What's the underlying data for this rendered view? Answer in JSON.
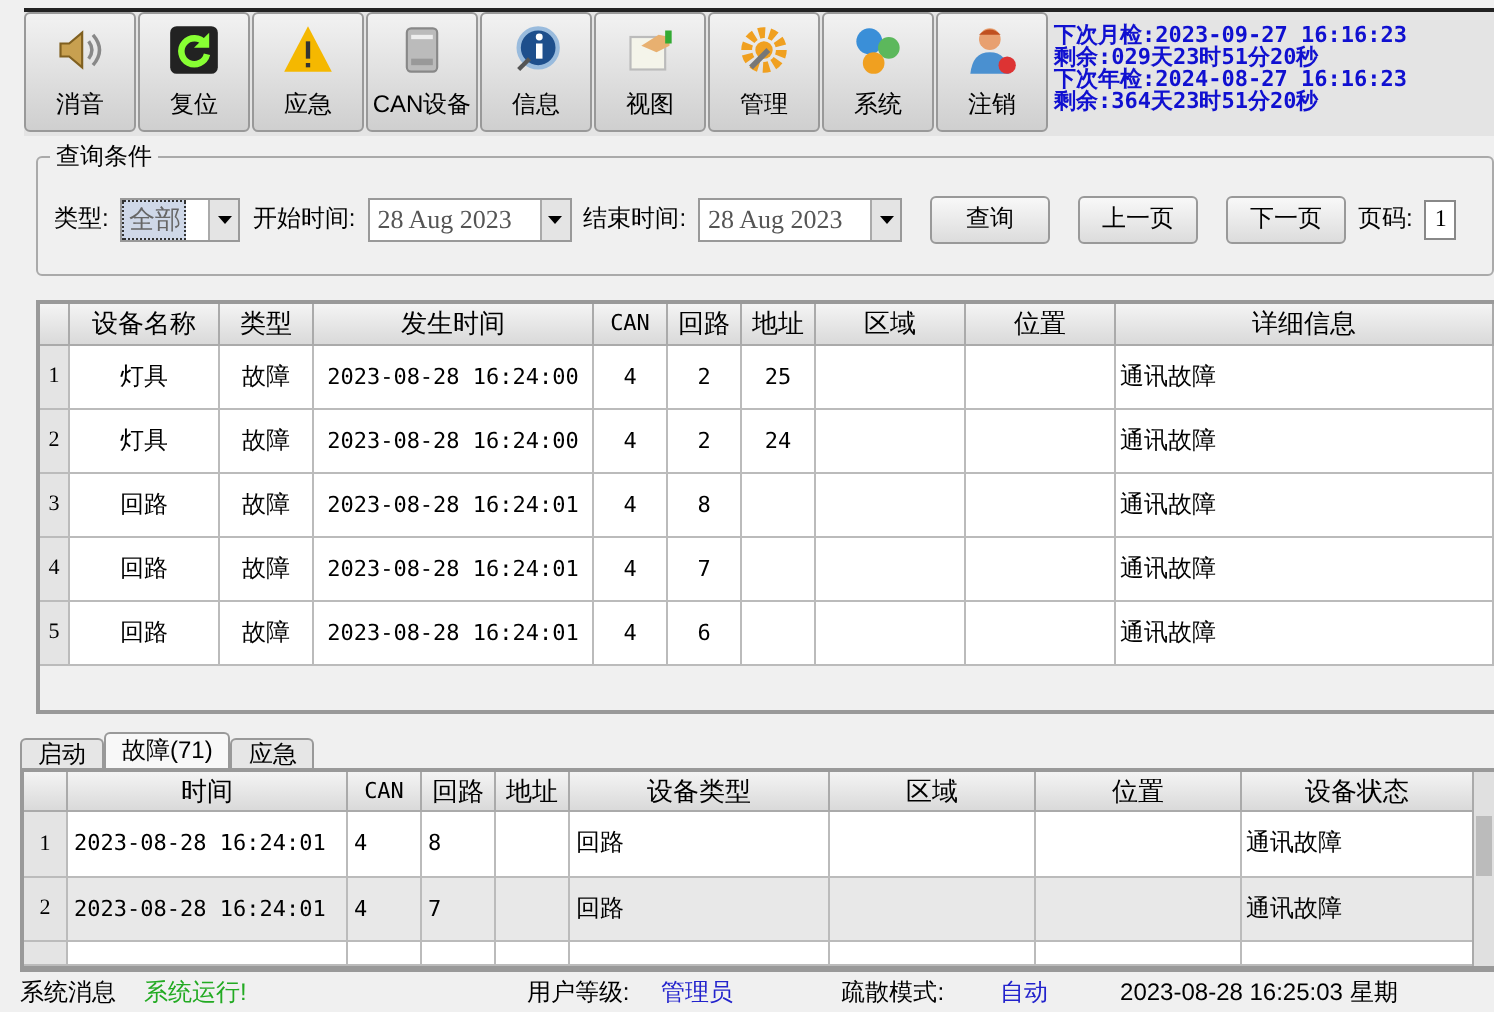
{
  "toolbar": {
    "buttons": [
      {
        "label": "消音"
      },
      {
        "label": "复位"
      },
      {
        "label": "应急"
      },
      {
        "label": "CAN设备"
      },
      {
        "label": "信息"
      },
      {
        "label": "视图"
      },
      {
        "label": "管理"
      },
      {
        "label": "系统"
      },
      {
        "label": "注销"
      }
    ],
    "info_lines": [
      "下次月检:2023-09-27 16:16:23",
      "剩余:029天23时51分20秒",
      "下次年检:2024-08-27 16:16:23",
      "剩余:364天23时51分20秒"
    ]
  },
  "query": {
    "legend": "查询条件",
    "type_label": "类型:",
    "type_value": "全部",
    "start_label": "开始时间:",
    "start_value": "28 Aug 2023",
    "end_label": "结束时间:",
    "end_value": "28 Aug 2023",
    "buttons": [
      "查询",
      "上一页",
      "下一页"
    ],
    "page_label": "页码:",
    "page_value": "1"
  },
  "main_table": {
    "columns": [
      "设备名称",
      "类型",
      "发生时间",
      "CAN",
      "回路",
      "地址",
      "区域",
      "位置",
      "详细信息"
    ],
    "rows": [
      {
        "index": "1",
        "cells": [
          "灯具",
          "故障",
          "2023-08-28 16:24:00",
          "4",
          "2",
          "25",
          "",
          "",
          "通讯故障"
        ]
      },
      {
        "index": "2",
        "cells": [
          "灯具",
          "故障",
          "2023-08-28 16:24:00",
          "4",
          "2",
          "24",
          "",
          "",
          "通讯故障"
        ]
      },
      {
        "index": "3",
        "cells": [
          "回路",
          "故障",
          "2023-08-28 16:24:01",
          "4",
          "8",
          "",
          "",
          "",
          "通讯故障"
        ]
      },
      {
        "index": "4",
        "cells": [
          "回路",
          "故障",
          "2023-08-28 16:24:01",
          "4",
          "7",
          "",
          "",
          "",
          "通讯故障"
        ]
      },
      {
        "index": "5",
        "cells": [
          "回路",
          "故障",
          "2023-08-28 16:24:01",
          "4",
          "6",
          "",
          "",
          "",
          "通讯故障"
        ]
      }
    ]
  },
  "tabs": [
    {
      "label": "启动",
      "selected": false
    },
    {
      "label": "故障(71)",
      "selected": true
    },
    {
      "label": "应急",
      "selected": false
    }
  ],
  "event_table": {
    "columns": [
      "时间",
      "CAN",
      "回路",
      "地址",
      "设备类型",
      "区域",
      "位置",
      "设备状态"
    ],
    "rows": [
      {
        "index": "1",
        "cells": [
          "2023-08-28 16:24:01",
          "4",
          "8",
          "",
          "回路",
          "",
          "",
          "通讯故障"
        ]
      },
      {
        "index": "2",
        "cells": [
          "2023-08-28 16:24:01",
          "4",
          "7",
          "",
          "回路",
          "",
          "",
          "通讯故障"
        ]
      }
    ]
  },
  "status_bar": {
    "items": [
      {
        "text": "系统消息",
        "kind": "label"
      },
      {
        "text": "系统运行!",
        "kind": "ok"
      },
      {
        "text": "用户等级:",
        "kind": "label"
      },
      {
        "text": "管理员",
        "kind": "value"
      },
      {
        "text": "疏散模式:",
        "kind": "label"
      },
      {
        "text": "自动",
        "kind": "value"
      },
      {
        "text": "2023-08-28 16:25:03 星期",
        "kind": "label"
      }
    ]
  }
}
